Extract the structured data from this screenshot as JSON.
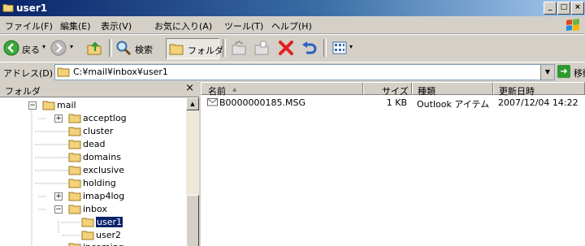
{
  "window": {
    "title": "user1"
  },
  "menu": [
    "ファイル(F)",
    "編集(E)",
    "表示(V)",
    "お気に入り(A)",
    "ツール(T)",
    "ヘルプ(H)"
  ],
  "toolbar": {
    "back_label": "戻る",
    "search_label": "検索",
    "folders_label": "フォルダ"
  },
  "address": {
    "label": "アドレス(D)",
    "path": "C:¥mail¥inbox¥user1",
    "go_label": "移動"
  },
  "folder_pane": {
    "title": "フォルダ",
    "close_glyph": "×",
    "tree": [
      {
        "label": "mail",
        "expander": "−"
      },
      {
        "label": "acceptlog",
        "expander": "+"
      },
      {
        "label": "cluster",
        "expander": ""
      },
      {
        "label": "dead",
        "expander": ""
      },
      {
        "label": "domains",
        "expander": ""
      },
      {
        "label": "exclusive",
        "expander": ""
      },
      {
        "label": "holding",
        "expander": ""
      },
      {
        "label": "imap4log",
        "expander": "+"
      },
      {
        "label": "inbox",
        "expander": "−"
      },
      {
        "label": "user1",
        "expander": "",
        "selected": true
      },
      {
        "label": "user2",
        "expander": ""
      },
      {
        "label": "incoming",
        "expander": ""
      }
    ]
  },
  "list": {
    "columns": [
      "名前",
      "サイズ",
      "種類",
      "更新日時"
    ],
    "sort_indicator": "▲",
    "rows": [
      {
        "name": "B0000000185.MSG",
        "size": "1 KB",
        "type": "Outlook アイテム",
        "modified": "2007/12/04 14:22"
      }
    ]
  },
  "colors": {
    "title_start": "#0a246a",
    "title_end": "#a6caf0",
    "selection": "#0a246a",
    "folder": "#f2d27a"
  }
}
